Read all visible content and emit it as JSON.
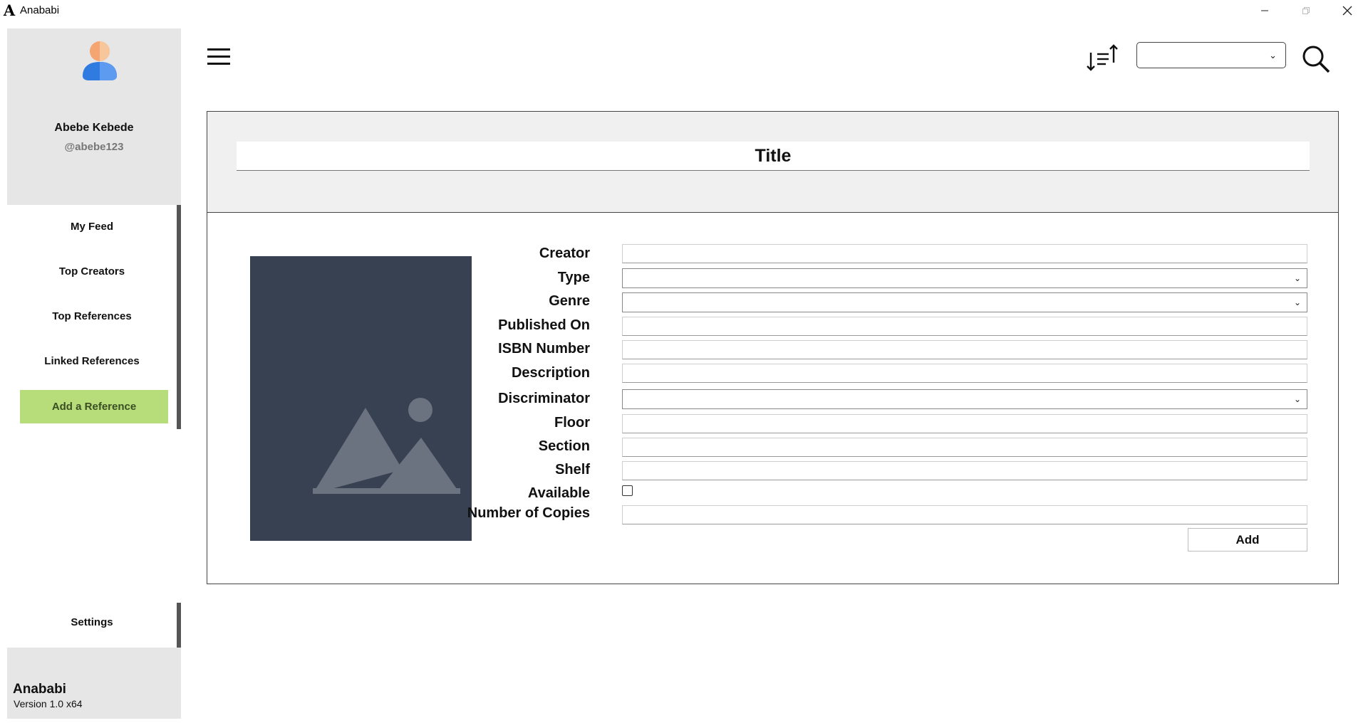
{
  "window": {
    "title": "Anababi",
    "logo_letter": "A",
    "controls": [
      "minimize",
      "maximize",
      "close"
    ]
  },
  "profile": {
    "name": "Abebe Kebede",
    "handle": "@abebe123",
    "avatar_icon": "user-avatar-icon"
  },
  "sidebar": {
    "items": [
      {
        "label": "My Feed"
      },
      {
        "label": "Top Creators"
      },
      {
        "label": "Top References"
      },
      {
        "label": "Linked References"
      }
    ],
    "primary_action": {
      "label": "Add a Reference",
      "color": "#b6dd79"
    },
    "settings_label": "Settings"
  },
  "footer": {
    "app_name": "Anababi",
    "version": "Version 1.0 x64"
  },
  "topbar": {
    "menu_icon": "hamburger-menu-icon",
    "sort_icon": "sort-icon",
    "sort_value": "",
    "search_icon": "search-icon"
  },
  "form": {
    "title_placeholder": "Title",
    "image_icon": "image-placeholder-icon",
    "fields": {
      "creator": {
        "label": "Creator",
        "value": ""
      },
      "type": {
        "label": "Type",
        "value": ""
      },
      "genre": {
        "label": "Genre",
        "value": ""
      },
      "published_on": {
        "label": "Published On",
        "value": ""
      },
      "isbn": {
        "label": "ISBN Number",
        "value": ""
      },
      "description": {
        "label": "Description",
        "value": ""
      },
      "discriminator": {
        "label": "Discriminator",
        "value": ""
      },
      "floor": {
        "label": "Floor",
        "value": ""
      },
      "section": {
        "label": "Section",
        "value": ""
      },
      "shelf": {
        "label": "Shelf",
        "value": ""
      },
      "available": {
        "label": "Available",
        "checked": false
      },
      "copies": {
        "label": "Number of Copies",
        "value": ""
      }
    },
    "submit_label": "Add"
  },
  "colors": {
    "sidebar_bg": "#e6e6e6",
    "accent_green": "#b6dd79",
    "image_placeholder_bg": "#374151"
  }
}
